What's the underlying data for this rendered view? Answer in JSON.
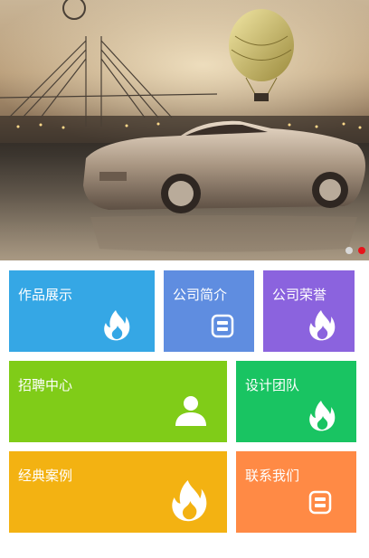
{
  "colors": {
    "slide_dot_inactive": "#d8d8d8",
    "slide_dot_active": "#e8141b"
  },
  "banner": {
    "icon": "car-photo",
    "dots": [
      {
        "active": false
      },
      {
        "active": true
      }
    ]
  },
  "tiles": [
    {
      "label": "作品展示",
      "icon": "flame-icon",
      "color": "#35a7e5"
    },
    {
      "label": "公司简介",
      "icon": "document-icon",
      "color": "#5f8de0"
    },
    {
      "label": "公司荣誉",
      "icon": "flame-icon",
      "color": "#8b63de"
    },
    {
      "label": "招聘中心",
      "icon": "user-icon",
      "color": "#80cc18"
    },
    {
      "label": "设计团队",
      "icon": "flame-icon",
      "color": "#19c462"
    },
    {
      "label": "经典案例",
      "icon": "flame-icon",
      "color": "#f3b212"
    },
    {
      "label": "联系我们",
      "icon": "document-icon",
      "color": "#ff8a45"
    }
  ]
}
